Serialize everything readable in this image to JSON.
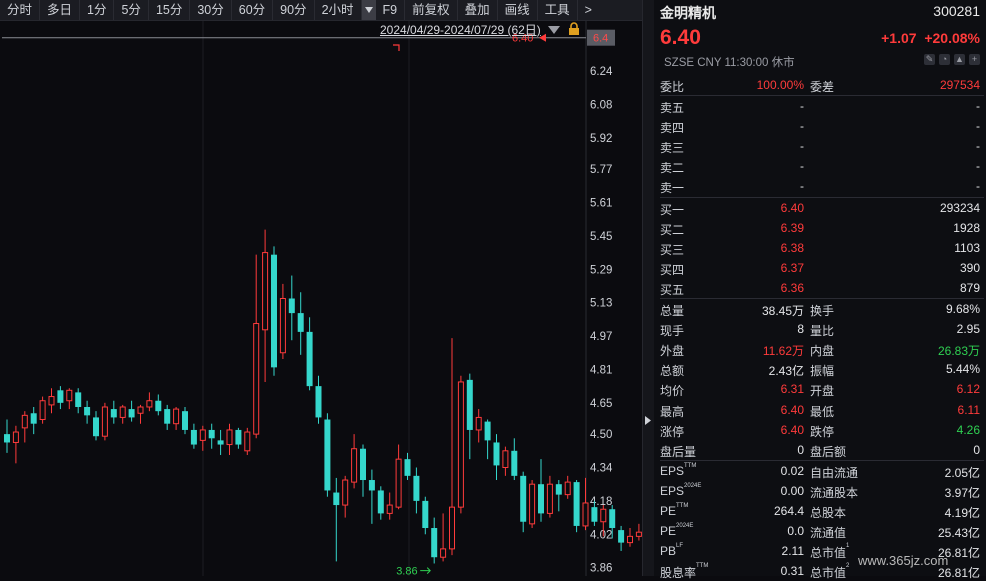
{
  "toolbar": {
    "items": [
      "分时",
      "多日",
      "1分",
      "5分",
      "15分",
      "30分",
      "60分",
      "90分",
      "2小时"
    ],
    "tail": [
      "F9",
      "前复权",
      "叠加",
      "画线",
      "工具"
    ],
    "more": ">"
  },
  "range": {
    "label": "2024/04/29-2024/07/29 (62日)"
  },
  "chart_data": {
    "type": "candlestick",
    "ylim": [
      3.82,
      6.48
    ],
    "yticks": [
      "6.24",
      "6.08",
      "5.92",
      "5.77",
      "5.61",
      "5.45",
      "5.29",
      "5.13",
      "4.97",
      "4.81",
      "4.65",
      "4.50",
      "4.34",
      "4.18",
      "4.02",
      "3.86"
    ],
    "current_line": {
      "value": 6.4,
      "label": "6.40",
      "tag": "6.4"
    },
    "low_marker": {
      "value": 3.86,
      "label": "3.86"
    },
    "candles": [
      [
        4.5,
        4.46,
        4.57,
        4.41
      ],
      [
        4.46,
        4.51,
        4.54,
        4.36
      ],
      [
        4.53,
        4.59,
        4.61,
        4.46
      ],
      [
        4.6,
        4.55,
        4.63,
        4.5
      ],
      [
        4.57,
        4.66,
        4.68,
        4.55
      ],
      [
        4.64,
        4.68,
        4.72,
        4.6
      ],
      [
        4.71,
        4.65,
        4.73,
        4.62
      ],
      [
        4.66,
        4.71,
        4.72,
        4.62
      ],
      [
        4.7,
        4.63,
        4.72,
        4.6
      ],
      [
        4.63,
        4.59,
        4.66,
        4.55
      ],
      [
        4.58,
        4.49,
        4.61,
        4.47
      ],
      [
        4.49,
        4.63,
        4.65,
        4.47
      ],
      [
        4.62,
        4.58,
        4.66,
        4.55
      ],
      [
        4.58,
        4.63,
        4.64,
        4.55
      ],
      [
        4.62,
        4.58,
        4.66,
        4.56
      ],
      [
        4.6,
        4.63,
        4.64,
        4.55
      ],
      [
        4.63,
        4.66,
        4.7,
        4.61
      ],
      [
        4.66,
        4.61,
        4.69,
        4.59
      ],
      [
        4.62,
        4.55,
        4.64,
        4.52
      ],
      [
        4.55,
        4.62,
        4.63,
        4.52
      ],
      [
        4.61,
        4.52,
        4.63,
        4.5
      ],
      [
        4.52,
        4.45,
        4.55,
        4.43
      ],
      [
        4.47,
        4.52,
        4.54,
        4.42
      ],
      [
        4.52,
        4.48,
        4.55,
        4.43
      ],
      [
        4.47,
        4.45,
        4.52,
        4.4
      ],
      [
        4.45,
        4.52,
        4.55,
        4.4
      ],
      [
        4.52,
        4.45,
        4.53,
        4.43
      ],
      [
        4.42,
        4.51,
        4.53,
        4.4
      ],
      [
        4.5,
        5.03,
        5.36,
        4.48
      ],
      [
        5.0,
        5.37,
        5.48,
        4.75
      ],
      [
        5.36,
        4.82,
        5.4,
        4.78
      ],
      [
        4.89,
        5.15,
        5.22,
        4.86
      ],
      [
        5.15,
        5.08,
        5.26,
        4.95
      ],
      [
        5.08,
        4.99,
        5.18,
        4.88
      ],
      [
        4.99,
        4.73,
        5.06,
        4.71
      ],
      [
        4.73,
        4.58,
        4.78,
        4.55
      ],
      [
        4.57,
        4.23,
        4.6,
        4.2
      ],
      [
        4.22,
        4.16,
        4.29,
        3.89
      ],
      [
        4.16,
        4.28,
        4.3,
        4.1
      ],
      [
        4.27,
        4.43,
        4.5,
        4.24
      ],
      [
        4.43,
        4.28,
        4.45,
        4.2
      ],
      [
        4.28,
        4.23,
        4.33,
        4.07
      ],
      [
        4.23,
        4.12,
        4.25,
        4.09
      ],
      [
        4.12,
        4.16,
        4.22,
        4.09
      ],
      [
        4.15,
        4.38,
        4.45,
        4.14
      ],
      [
        4.38,
        4.3,
        4.41,
        4.28
      ],
      [
        4.3,
        4.18,
        4.34,
        4.12
      ],
      [
        4.18,
        4.05,
        4.2,
        4.02
      ],
      [
        4.05,
        3.91,
        4.1,
        3.88
      ],
      [
        3.91,
        3.95,
        4.12,
        3.89
      ],
      [
        3.95,
        4.15,
        4.96,
        3.92
      ],
      [
        4.15,
        4.75,
        4.78,
        4.12
      ],
      [
        4.76,
        4.52,
        4.79,
        4.38
      ],
      [
        4.52,
        4.58,
        4.62,
        4.46
      ],
      [
        4.56,
        4.47,
        4.57,
        4.38
      ],
      [
        4.46,
        4.35,
        4.5,
        4.28
      ],
      [
        4.34,
        4.42,
        4.44,
        4.3
      ],
      [
        4.42,
        4.3,
        4.48,
        4.28
      ],
      [
        4.3,
        4.08,
        4.32,
        4.03
      ],
      [
        4.07,
        4.26,
        4.28,
        4.05
      ],
      [
        4.26,
        4.12,
        4.38,
        4.08
      ],
      [
        4.12,
        4.26,
        4.3,
        4.1
      ],
      [
        4.26,
        4.21,
        4.28,
        4.13
      ],
      [
        4.21,
        4.27,
        4.3,
        4.19
      ],
      [
        4.27,
        4.06,
        4.28,
        4.03
      ],
      [
        4.06,
        4.17,
        4.29,
        4.04
      ],
      [
        4.15,
        4.08,
        4.18,
        4.06
      ],
      [
        4.08,
        4.14,
        4.16,
        4.01
      ],
      [
        4.14,
        4.05,
        4.16,
        4.0
      ],
      [
        4.04,
        3.98,
        4.06,
        3.94
      ],
      [
        3.98,
        4.01,
        4.05,
        3.96
      ],
      [
        4.01,
        4.03,
        4.07,
        3.99
      ],
      [
        4.02,
        4.05,
        4.12,
        4.0
      ],
      [
        4.06,
        4.04,
        4.08,
        4.0
      ],
      [
        4.04,
        4.19,
        4.3,
        4.02
      ],
      [
        4.19,
        4.37,
        4.62,
        4.17
      ],
      [
        4.37,
        5.29,
        5.3,
        4.36
      ],
      [
        6.11,
        6.4,
        6.4,
        6.11
      ]
    ]
  },
  "panel": {
    "name": "金明精机",
    "code": "300281",
    "price": "6.40",
    "change": "+1.07",
    "change_pct": "+20.08%",
    "meta": "SZSE  CNY  11:30:00  休市",
    "top_rows": [
      {
        "l1": "委比",
        "v1": "100.00%",
        "c1": "red",
        "l2": "委差",
        "v2": "297534",
        "c2": "red",
        "sep": true
      }
    ],
    "ask_rows": [
      {
        "l1": "卖五",
        "v1": "-",
        "c1": "white",
        "v2": "-",
        "c2": "white"
      },
      {
        "l1": "卖四",
        "v1": "-",
        "c1": "white",
        "v2": "-",
        "c2": "white"
      },
      {
        "l1": "卖三",
        "v1": "-",
        "c1": "white",
        "v2": "-",
        "c2": "white"
      },
      {
        "l1": "卖二",
        "v1": "-",
        "c1": "white",
        "v2": "-",
        "c2": "white"
      },
      {
        "l1": "卖一",
        "v1": "-",
        "c1": "white",
        "v2": "-",
        "c2": "white"
      }
    ],
    "bid_rows": [
      {
        "l1": "买一",
        "v1": "6.40",
        "c1": "red",
        "v2": "293234",
        "c2": "white"
      },
      {
        "l1": "买二",
        "v1": "6.39",
        "c1": "red",
        "v2": "1928",
        "c2": "white"
      },
      {
        "l1": "买三",
        "v1": "6.38",
        "c1": "red",
        "v2": "1103",
        "c2": "white"
      },
      {
        "l1": "买四",
        "v1": "6.37",
        "c1": "red",
        "v2": "390",
        "c2": "white"
      },
      {
        "l1": "买五",
        "v1": "6.36",
        "c1": "red",
        "v2": "879",
        "c2": "white"
      }
    ],
    "stat_rows": [
      {
        "l1": "总量",
        "v1": "38.45万",
        "c1": "white",
        "l2": "换手",
        "v2": "9.68%",
        "c2": "white"
      },
      {
        "l1": "现手",
        "v1": "8",
        "c1": "white",
        "l2": "量比",
        "v2": "2.95",
        "c2": "white"
      },
      {
        "l1": "外盘",
        "v1": "11.62万",
        "c1": "red",
        "l2": "内盘",
        "v2": "26.83万",
        "c2": "green"
      },
      {
        "l1": "总额",
        "v1": "2.43亿",
        "c1": "white",
        "l2": "振幅",
        "v2": "5.44%",
        "c2": "white"
      },
      {
        "l1": "均价",
        "v1": "6.31",
        "c1": "red",
        "l2": "开盘",
        "v2": "6.12",
        "c2": "red"
      },
      {
        "l1": "最高",
        "v1": "6.40",
        "c1": "red",
        "l2": "最低",
        "v2": "6.11",
        "c2": "red"
      },
      {
        "l1": "涨停",
        "v1": "6.40",
        "c1": "red",
        "l2": "跌停",
        "v2": "4.26",
        "c2": "green"
      },
      {
        "l1": "盘后量",
        "v1": "0",
        "c1": "white",
        "l2": "盘后额",
        "v2": "0",
        "c2": "white"
      }
    ],
    "fund_rows": [
      {
        "l1": "EPS",
        "s1": "TTM",
        "v1": "0.02",
        "c1": "white",
        "l2": "自由流通",
        "v2": "2.05亿",
        "c2": "white"
      },
      {
        "l1": "EPS",
        "s1": "2024E",
        "v1": "0.00",
        "c1": "white",
        "l2": "流通股本",
        "v2": "3.97亿",
        "c2": "white"
      },
      {
        "l1": "PE",
        "s1": "TTM",
        "v1": "264.4",
        "c1": "white",
        "l2": "总股本",
        "v2": "4.19亿",
        "c2": "white"
      },
      {
        "l1": "PE",
        "s1": "2024E",
        "v1": "0.0",
        "c1": "white",
        "l2": "流通值",
        "v2": "25.43亿",
        "c2": "white"
      },
      {
        "l1": "PB",
        "s1": "LF",
        "v1": "2.11",
        "c1": "white",
        "l2": "总市值",
        "s2": "1",
        "v2": "26.81亿",
        "c2": "white"
      },
      {
        "l1": "股息率",
        "s1": "TTM",
        "v1": "0.31",
        "c1": "white",
        "l2": "总市值",
        "s2": "2",
        "v2": "26.81亿",
        "c2": "white"
      }
    ]
  },
  "watermark": "www.365jz.com"
}
